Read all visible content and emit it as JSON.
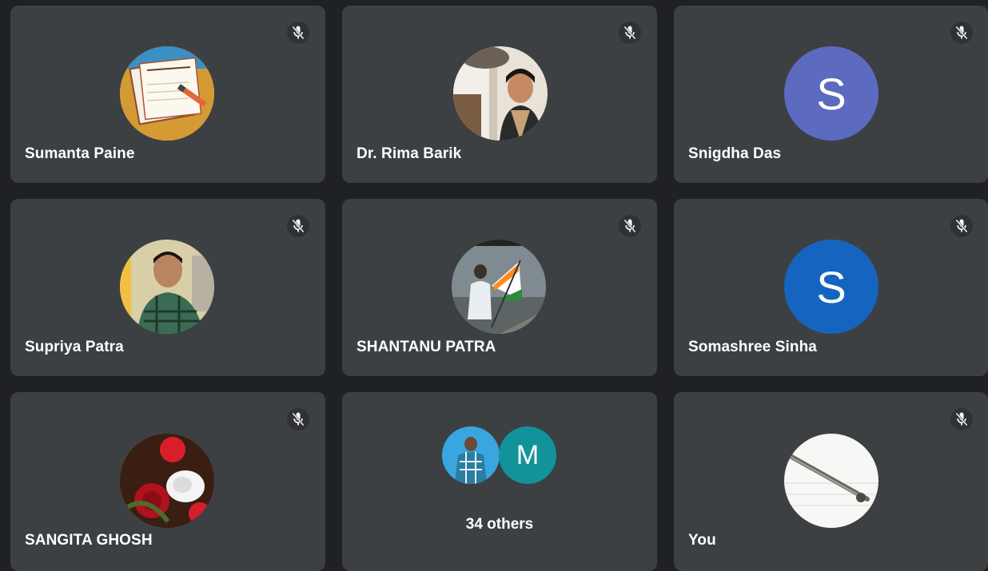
{
  "participants": [
    {
      "name": "Sumanta Paine",
      "avatar": "math-notebook-avatar",
      "muted": true
    },
    {
      "name": "Dr. Rima Barik",
      "avatar": "photo-avatar",
      "muted": true
    },
    {
      "name": "Snigdha Das",
      "avatar_letter": "S",
      "avatar_color": "#5c6bc0",
      "muted": true
    },
    {
      "name": "Supriya Patra",
      "avatar": "photo-avatar",
      "muted": true
    },
    {
      "name": "SHANTANU PATRA",
      "avatar": "photo-avatar-flag",
      "muted": true
    },
    {
      "name": "Somashree Sinha",
      "avatar_letter": "S",
      "avatar_color": "#1565c0",
      "muted": true
    },
    {
      "name": "SANGITA GHOSH",
      "avatar": "rose-photo-avatar",
      "muted": true
    },
    {
      "name": "You",
      "avatar": "pen-photo-avatar",
      "muted": true
    }
  ],
  "others_tile": {
    "label": "34 others",
    "avatar_letter": "M",
    "avatar_color": "#12939a"
  },
  "colors": {
    "background": "#202124",
    "tile": "#3c4043"
  }
}
